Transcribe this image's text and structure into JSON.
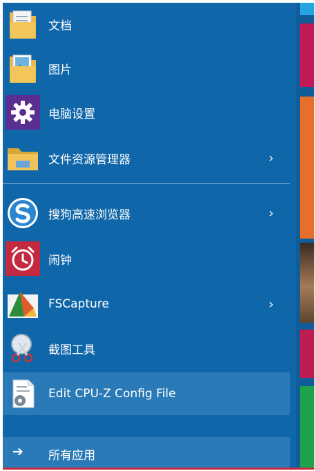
{
  "menu": {
    "items": [
      {
        "label": "文档",
        "icon": "folder-documents-icon",
        "has_submenu": false
      },
      {
        "label": "图片",
        "icon": "folder-pictures-icon",
        "has_submenu": false
      },
      {
        "label": "电脑设置",
        "icon": "gear-icon",
        "has_submenu": false
      },
      {
        "label": "文件资源管理器",
        "icon": "file-explorer-icon",
        "has_submenu": true
      },
      {
        "label": "搜狗高速浏览器",
        "icon": "sogou-browser-icon",
        "has_submenu": true
      },
      {
        "label": "闹钟",
        "icon": "alarm-clock-icon",
        "has_submenu": false
      },
      {
        "label": "FSCapture",
        "icon": "fscapture-icon",
        "has_submenu": true
      },
      {
        "label": "截图工具",
        "icon": "snipping-tool-icon",
        "has_submenu": false
      },
      {
        "label": "Edit CPU-Z Config File",
        "icon": "config-file-icon",
        "has_submenu": false
      }
    ],
    "chevron": "›",
    "all_apps_label": "所有应用",
    "all_apps_arrow": "➔"
  },
  "colors": {
    "menu_bg": "#0f66a9",
    "highlight": "#2a7ab7",
    "accent_red": "#c8293b"
  }
}
